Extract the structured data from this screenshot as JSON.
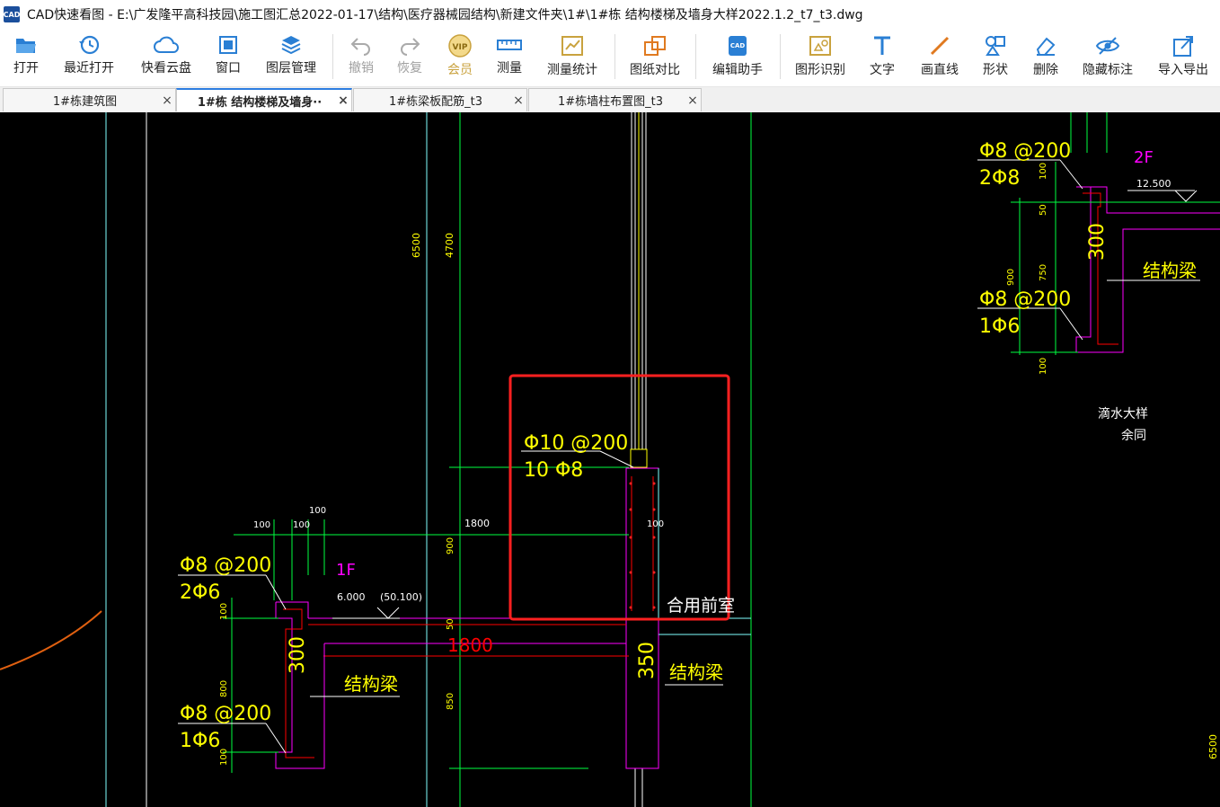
{
  "window": {
    "title": "CAD快速看图 - E:\\广发隆平高科技园\\施工图汇总2022-01-17\\结构\\医疗器械园结构\\新建文件夹\\1#\\1#栋 结构楼梯及墙身大样2022.1.2_t7_t3.dwg",
    "logo_text": "CAD"
  },
  "toolbar": {
    "open": "打开",
    "recent": "最近打开",
    "cloud": "快看云盘",
    "window": "窗口",
    "layers": "图层管理",
    "undo": "撤销",
    "redo": "恢复",
    "vip_badge": "VIP",
    "vip": "会员",
    "measure": "测量",
    "measure_stats": "测量统计",
    "compare": "图纸对比",
    "edit_assistant": "编辑助手",
    "shape_recognize": "图形识别",
    "text": "文字",
    "line": "画直线",
    "shape": "形状",
    "delete": "删除",
    "hide_marks": "隐藏标注",
    "import_export": "导入导出"
  },
  "tabs": [
    {
      "label": "1#栋建筑图",
      "close": "×"
    },
    {
      "label": "1#栋  结构楼梯及墙身··",
      "close": "×"
    },
    {
      "label": "1#栋梁板配筋_t3",
      "close": "×"
    },
    {
      "label": "1#栋墙柱布置图_t3",
      "close": "×"
    }
  ],
  "drawing": {
    "dim_6500_left": "6500",
    "dim_4700": "4700",
    "dim_6500_right": "6500",
    "upper": {
      "rebar1": "Φ8 @200",
      "rebar1b": "2Φ8",
      "level": "2F",
      "elev": "12.500",
      "d100a": "100",
      "d50": "50",
      "d750": "750",
      "d900": "900",
      "d100b": "100",
      "beam_depth": "300",
      "beam_label": "结构梁",
      "rebar2": "Φ8 @200",
      "rebar2b": "1Φ6",
      "note1": "滴水大样",
      "note2": "余同"
    },
    "center": {
      "rebar": "Φ10 @200",
      "rebar_b": "10 Φ8",
      "d900": "900",
      "d1800": "1800",
      "d100": "100",
      "room": "合用前室",
      "d50": "50",
      "beam_width": "1800",
      "d850": "850",
      "beam_depth": "350",
      "beam_label": "结构梁"
    },
    "lower": {
      "d100a": "100",
      "d100b": "100",
      "d100c": "100",
      "rebar1": "Φ8 @200",
      "rebar1b": "2Φ6",
      "level": "1F",
      "elev": "6.000",
      "elev2": "(50.100)",
      "d100d": "100",
      "d800": "800",
      "d100e": "100",
      "beam_depth": "300",
      "beam_label": "结构梁",
      "rebar2": "Φ8 @200",
      "rebar2b": "1Φ6"
    }
  },
  "colors": {
    "canvas_bg": "#000000",
    "yellow": "#ffff00",
    "green": "#00ff40",
    "magenta": "#ff00ff",
    "red": "#ff0000",
    "cyan": "#00e0e0",
    "white": "#ffffff",
    "orange": "#e06010",
    "highlight": "#ff2020",
    "accent": "#2d7de0"
  }
}
